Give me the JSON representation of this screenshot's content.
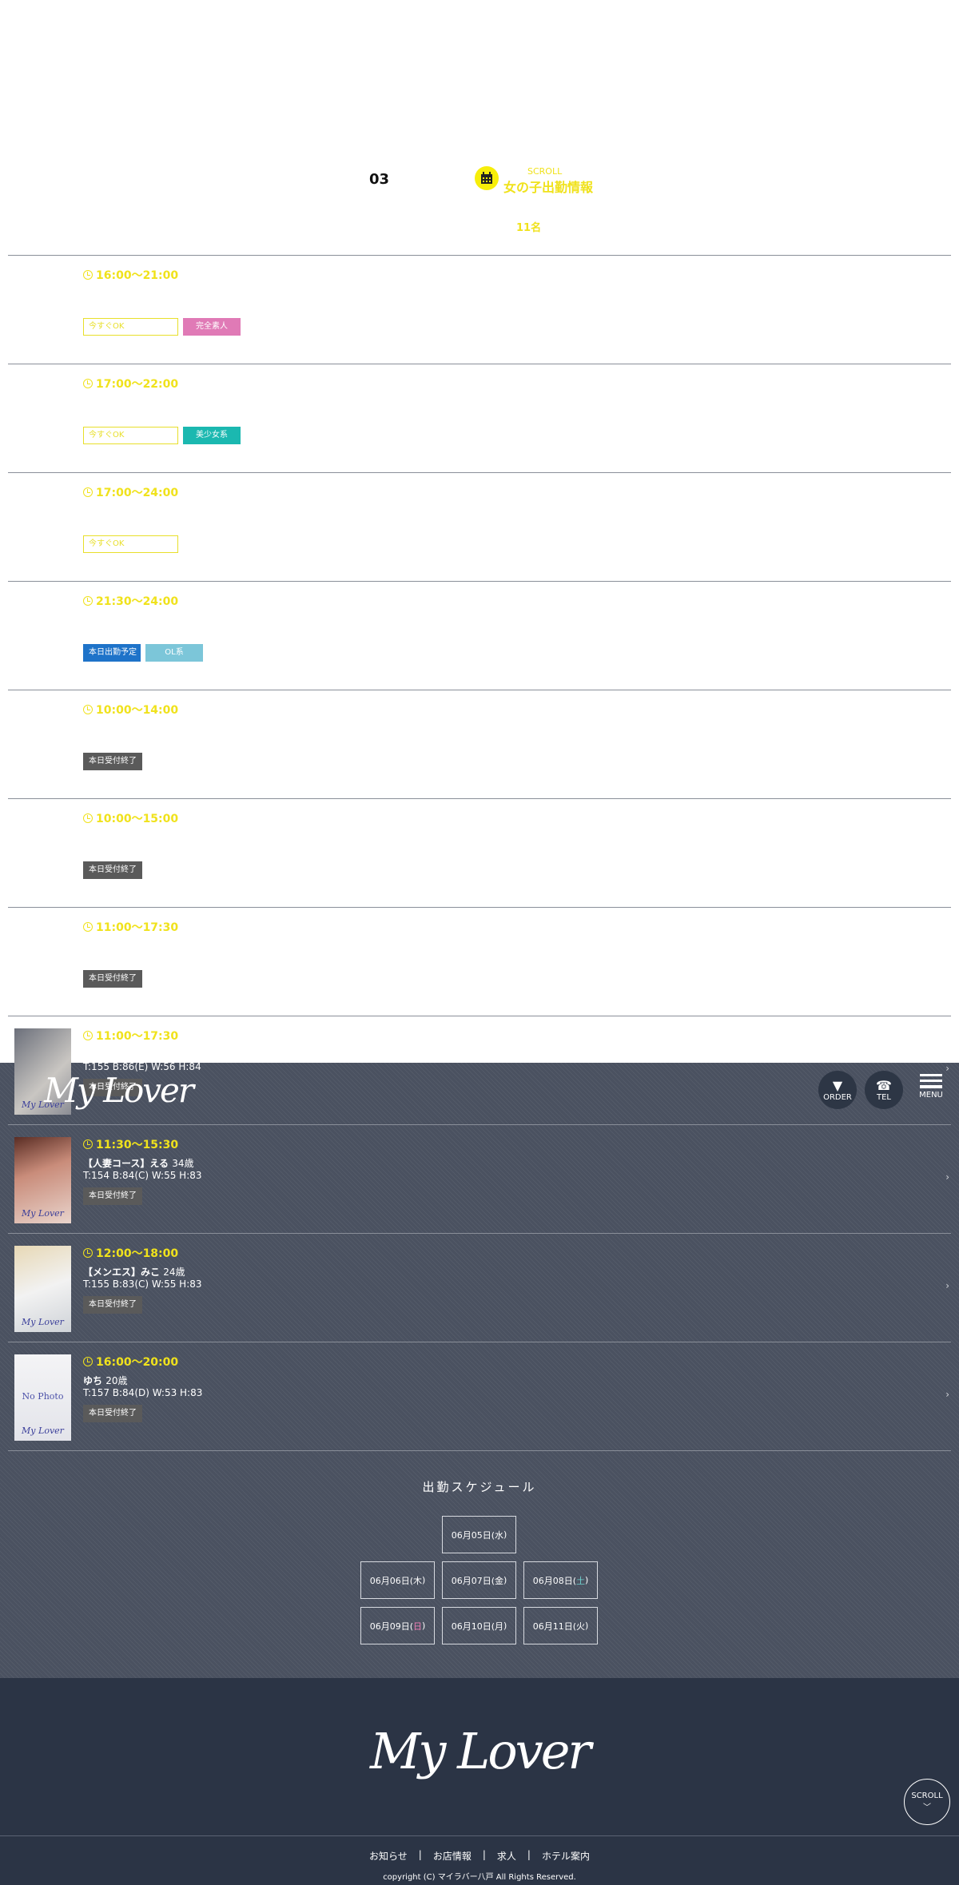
{
  "header": {
    "section_number": "03",
    "scroll_label": "SCROLL",
    "title": "女の子出勤情報",
    "count": "11名"
  },
  "entries": [
    {
      "time": "16:00〜21:00",
      "tags": [
        {
          "label": "今すぐOK",
          "style": "now"
        },
        {
          "label": "完全素人",
          "style": "pink"
        }
      ]
    },
    {
      "time": "17:00〜22:00",
      "tags": [
        {
          "label": "今すぐOK",
          "style": "now"
        },
        {
          "label": "美少女系",
          "style": "teal"
        }
      ]
    },
    {
      "time": "17:00〜24:00",
      "tags": [
        {
          "label": "今すぐOK",
          "style": "now"
        }
      ]
    },
    {
      "time": "21:30〜24:00",
      "tags": [
        {
          "label": "本日出勤予定",
          "style": "blue"
        },
        {
          "label": "OL系",
          "style": "lblue"
        }
      ]
    },
    {
      "time": "10:00〜14:00",
      "tags": [
        {
          "label": "本日受付終了",
          "style": "closed"
        }
      ]
    },
    {
      "time": "10:00〜15:00",
      "tags": [
        {
          "label": "本日受付終了",
          "style": "closed"
        }
      ]
    },
    {
      "time": "11:00〜17:30",
      "tags": [
        {
          "label": "本日受付終了",
          "style": "closed"
        }
      ]
    },
    {
      "time": "11:00〜17:30",
      "spec": "T:155 B:86(E) W:56 H:84",
      "tags": [
        {
          "label": "本日受付終了",
          "style": "closed"
        }
      ]
    },
    {
      "time": "11:30〜15:30",
      "name": "【人妻コース】える",
      "age": "34歳",
      "spec": "T:154 B:84(C) W:55 H:83",
      "tags": [
        {
          "label": "本日受付終了",
          "style": "closed"
        }
      ]
    },
    {
      "time": "12:00〜18:00",
      "name": "【メンエス】みこ",
      "age": "24歳",
      "spec": "T:155 B:83(C) W:55 H:83",
      "tags": [
        {
          "label": "本日受付終了",
          "style": "closed"
        }
      ]
    },
    {
      "time": "16:00〜20:00",
      "name": "ゆち",
      "age": "20歳",
      "spec": "T:157 B:84(D) W:53 H:83",
      "tags": [
        {
          "label": "本日受付終了",
          "style": "closed"
        }
      ]
    }
  ],
  "photo_labels": {
    "no_photo": "No Photo",
    "watermark": "My Lover"
  },
  "overlay": {
    "logo": "My Lover",
    "order_label": "ORDER",
    "tel_label": "TEL",
    "menu_label": "MENU"
  },
  "schedule": {
    "heading": "出勤スケジュール",
    "dates": [
      {
        "prefix": "06月05日(",
        "day": "水",
        "suffix": ")",
        "kind": "weekday"
      },
      {
        "prefix": "06月06日(",
        "day": "木",
        "suffix": ")",
        "kind": "weekday"
      },
      {
        "prefix": "06月07日(",
        "day": "金",
        "suffix": ")",
        "kind": "weekday"
      },
      {
        "prefix": "06月08日(",
        "day": "土",
        "suffix": ")",
        "kind": "sat"
      },
      {
        "prefix": "06月09日(",
        "day": "日",
        "suffix": ")",
        "kind": "sun"
      },
      {
        "prefix": "06月10日(",
        "day": "月",
        "suffix": ")",
        "kind": "weekday"
      },
      {
        "prefix": "06月11日(",
        "day": "火",
        "suffix": ")",
        "kind": "weekday"
      }
    ]
  },
  "footer": {
    "logo": "My Lover",
    "nav": [
      "お知らせ",
      "お店情報",
      "求人",
      "ホテル案内"
    ],
    "separator": "|",
    "copyright": "copyright (C) マイラバー八戸 All Rights Reserved.",
    "scroll_label": "SCROLL"
  },
  "colors": {
    "accent_yellow": "#f0e21c",
    "dark_bg": "#4a5160",
    "footer_bg": "#2b3445"
  }
}
